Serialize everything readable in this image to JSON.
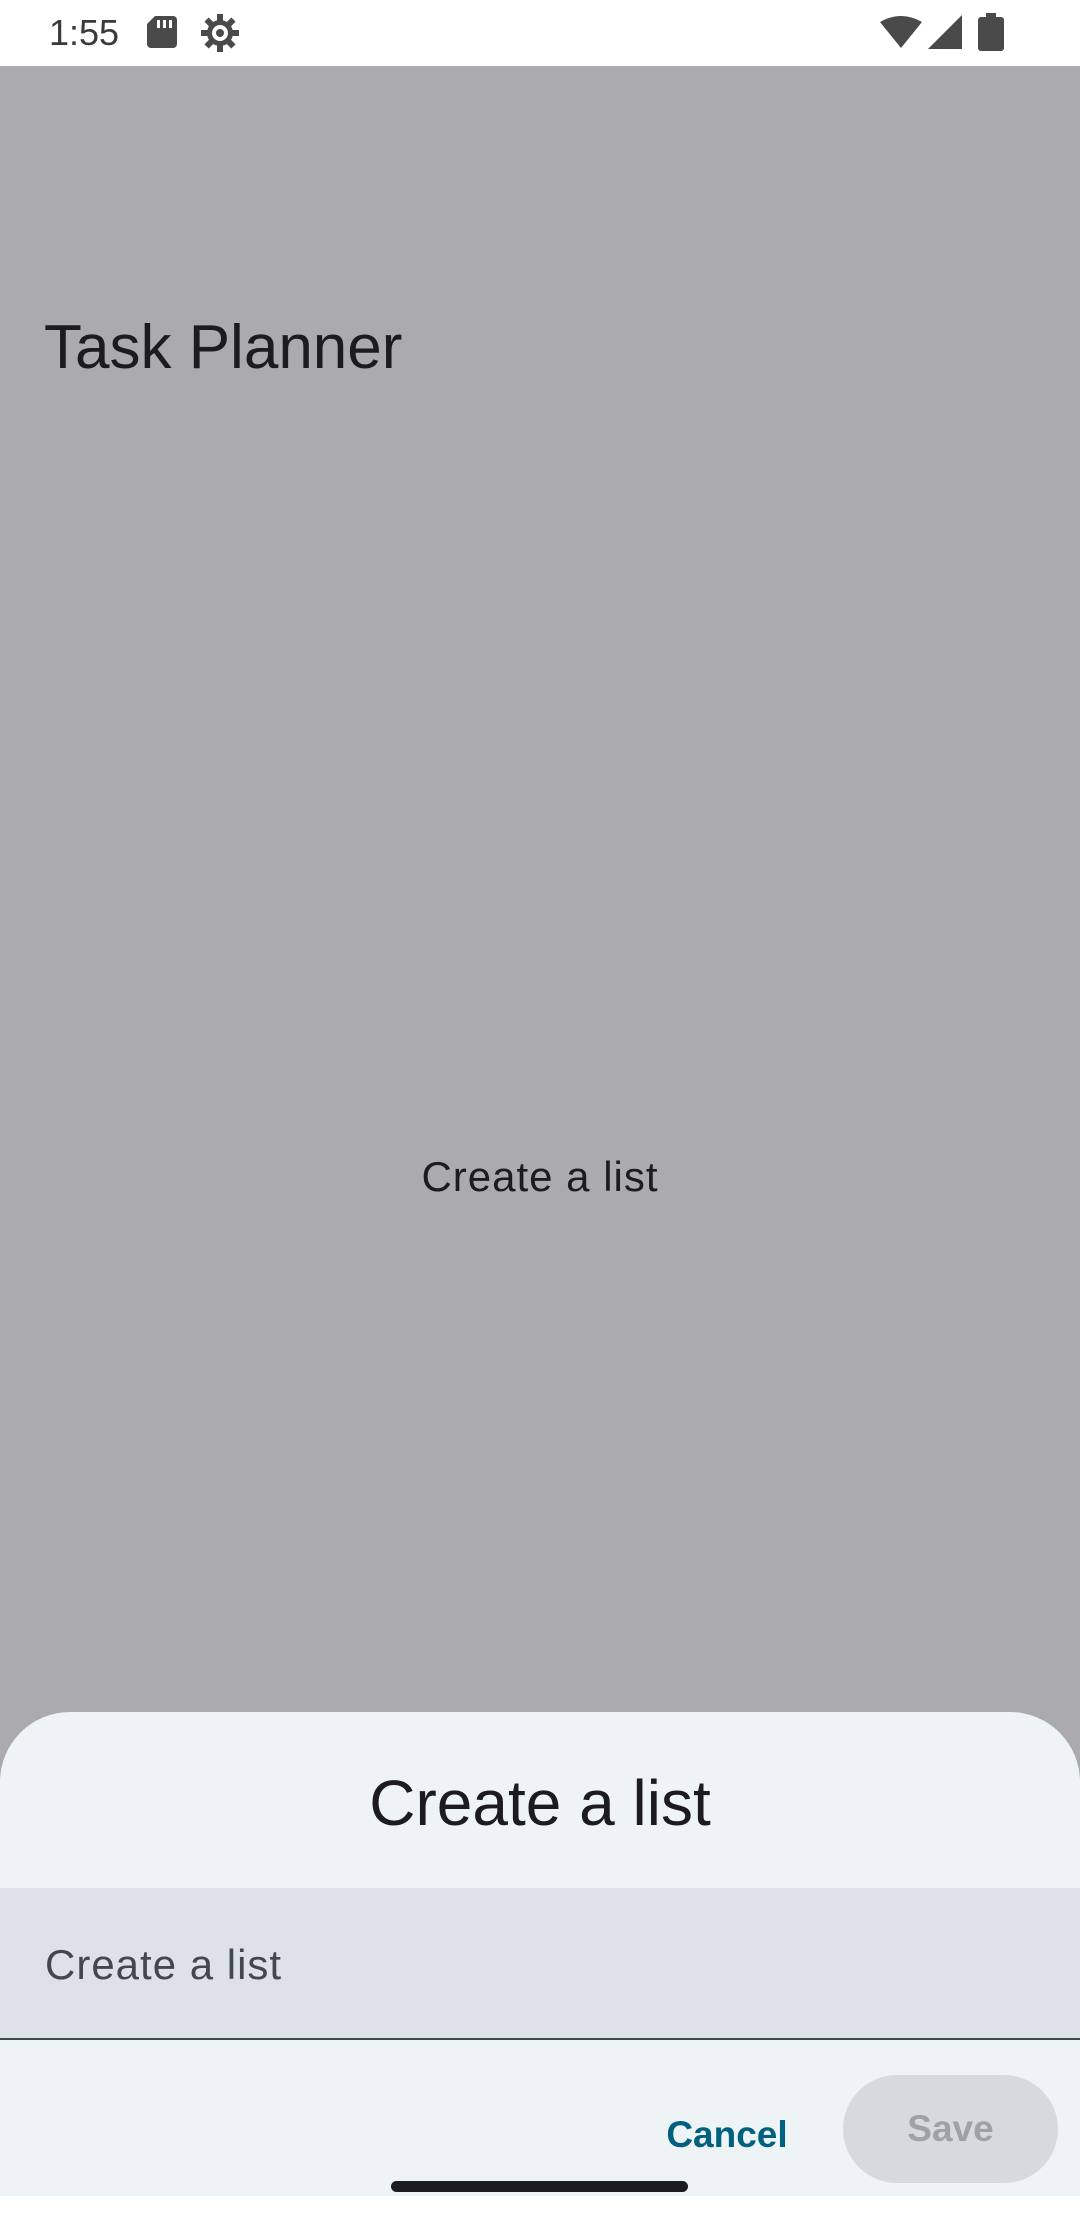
{
  "status_bar": {
    "time": "1:55",
    "icons": [
      "sd-card-icon",
      "settings-icon",
      "wifi-icon",
      "signal-icon",
      "battery-icon"
    ]
  },
  "app": {
    "title": "Task Planner",
    "empty_message": "Create a list"
  },
  "dialog": {
    "title": "Create a list",
    "input": {
      "placeholder": "Create a list",
      "value": ""
    },
    "cancel_label": "Cancel",
    "save_label": "Save"
  },
  "colors": {
    "scrim": "#ababad",
    "sheet": "#eef3f6",
    "field": "#dce2e8",
    "accent": "#00617f",
    "disabled_button": "#d6dadd",
    "disabled_text": "#9ea2a5"
  }
}
